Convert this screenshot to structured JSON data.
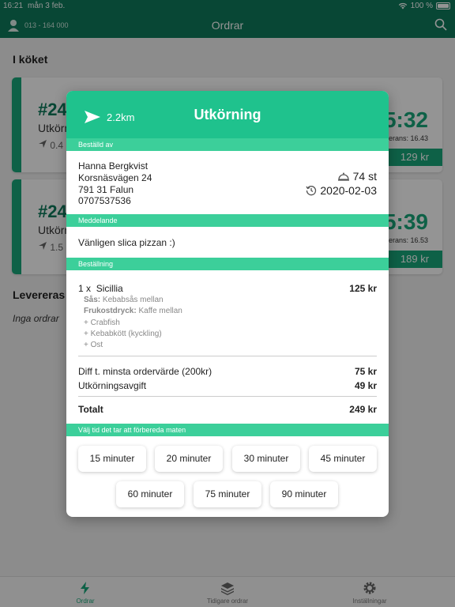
{
  "status_bar": {
    "time": "16:21",
    "date": "mån 3 feb.",
    "battery": "100 %"
  },
  "header": {
    "phone": "013 - 164 000",
    "title": "Ordrar"
  },
  "kitchen": {
    "title": "I köket",
    "orders": [
      {
        "number": "#24",
        "type": "Utkörn",
        "distance": "0.4",
        "clock": "5:32",
        "delivery": "erans: 16.43",
        "price": "129 kr"
      },
      {
        "number": "#24",
        "type": "Utkörn",
        "distance": "1.5",
        "clock": "5:39",
        "delivery": "erans: 16.53",
        "price": "189 kr"
      }
    ]
  },
  "delivered": {
    "title": "Levereras j",
    "empty": "Inga ordrar"
  },
  "modal": {
    "distance": "2.2km",
    "title": "Utkörning",
    "ordered_by_label": "Beställd av",
    "customer": {
      "name": "Hanna Bergkvist",
      "street": "Korsnäsvägen 24",
      "city": "791 31 Falun",
      "phone": "0707537536"
    },
    "count": "74 st",
    "date": "2020-02-03",
    "message_label": "Meddelande",
    "message": "Vänligen slica pizzan :)",
    "order_label": "Beställning",
    "item": {
      "qty": "1 x",
      "name": "Sicillia",
      "price": "125 kr",
      "options": [
        {
          "key": "Sås:",
          "value": " Kebabsås mellan"
        },
        {
          "key": "Frukostdryck:",
          "value": " Kaffe mellan"
        }
      ],
      "extras": [
        "+ Crabfish",
        "+ Kebabkött (kyckling)",
        "+ Ost"
      ]
    },
    "fees": [
      {
        "label": "Diff t. minsta ordervärde (200kr)",
        "amount": "75 kr"
      },
      {
        "label": "Utkörningsavgift",
        "amount": "49 kr"
      }
    ],
    "total_label": "Totalt",
    "total": "249 kr",
    "prep_label": "Välj tid det tar att förbereda maten",
    "times_row1": [
      "15 minuter",
      "20 minuter",
      "30 minuter",
      "45 minuter"
    ],
    "times_row2": [
      "60 minuter",
      "75 minuter",
      "90 minuter"
    ]
  },
  "tabs": [
    {
      "label": "Ordrar",
      "icon": "bolt-icon",
      "active": true
    },
    {
      "label": "Tidigare ordrar",
      "icon": "layers-icon",
      "active": false
    },
    {
      "label": "Inställningar",
      "icon": "gear-icon",
      "active": false
    }
  ],
  "colors": {
    "header": "#0f7a5c",
    "accent": "#1fc28d",
    "section": "#3ccf9a"
  }
}
